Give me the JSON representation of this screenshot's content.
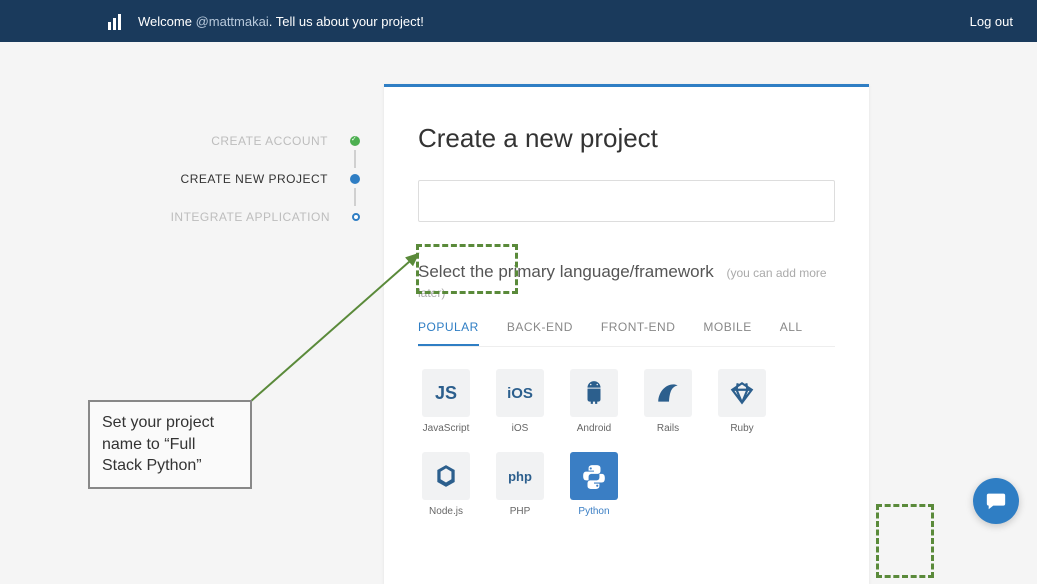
{
  "topbar": {
    "welcome_prefix": "Welcome ",
    "username": "@mattmakai",
    "welcome_suffix": ". Tell us about your project!",
    "logout": "Log out"
  },
  "steps": {
    "items": [
      {
        "label": "CREATE ACCOUNT",
        "state": "done"
      },
      {
        "label": "CREATE NEW PROJECT",
        "state": "current"
      },
      {
        "label": "INTEGRATE APPLICATION",
        "state": "pending"
      }
    ]
  },
  "card": {
    "title": "Create a new project",
    "project_name_value": "",
    "section_label": "Select the primary language/framework",
    "section_hint": "(you can add more later)"
  },
  "tabs": [
    "POPULAR",
    "BACK-END",
    "FRONT-END",
    "MOBILE",
    "ALL"
  ],
  "active_tab": "POPULAR",
  "tiles": [
    {
      "id": "javascript",
      "label": "JavaScript",
      "glyph": "JS"
    },
    {
      "id": "ios",
      "label": "iOS",
      "glyph": "iOS"
    },
    {
      "id": "android",
      "label": "Android",
      "glyph": "android-icon"
    },
    {
      "id": "rails",
      "label": "Rails",
      "glyph": "rails-icon"
    },
    {
      "id": "ruby",
      "label": "Ruby",
      "glyph": "ruby-icon"
    },
    {
      "id": "nodejs",
      "label": "Node.js",
      "glyph": "node-icon"
    },
    {
      "id": "php",
      "label": "PHP",
      "glyph": "php"
    },
    {
      "id": "python",
      "label": "Python",
      "glyph": "python-icon",
      "selected": true
    }
  ],
  "annotation": {
    "text": "Set your project name to “Full Stack Python”"
  }
}
